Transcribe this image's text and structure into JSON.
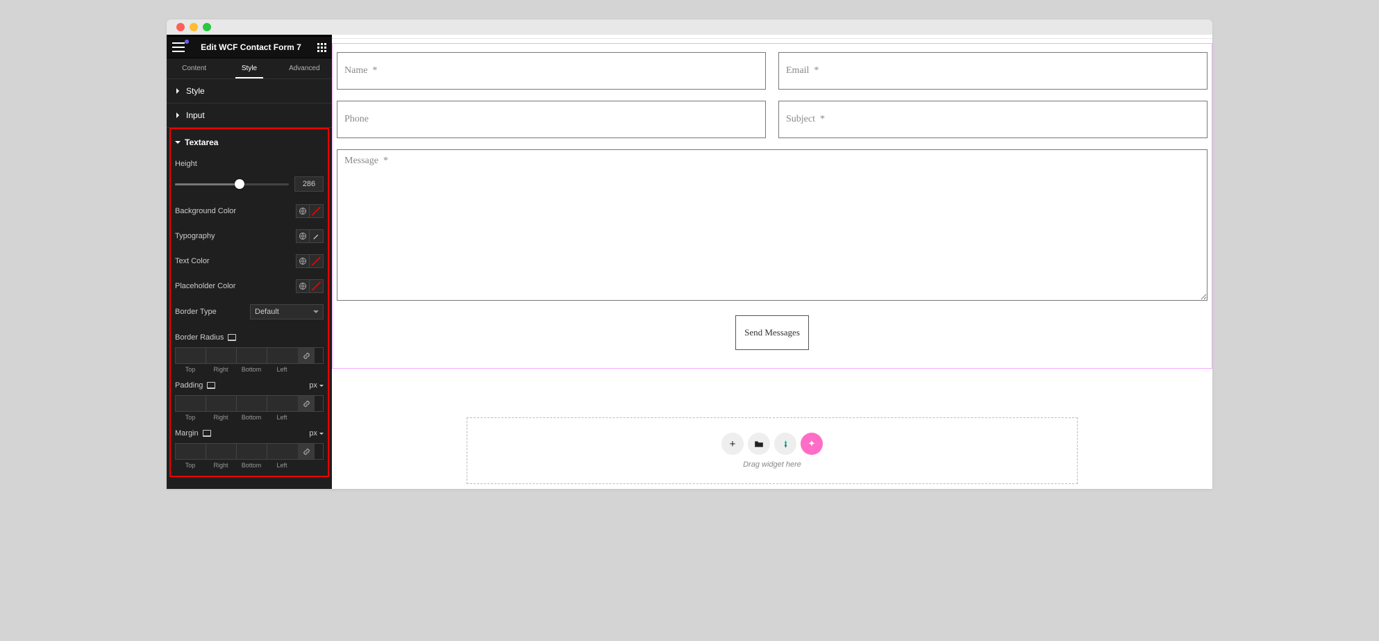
{
  "header": {
    "title": "Edit WCF Contact Form 7"
  },
  "tabs": {
    "content": "Content",
    "style": "Style",
    "advanced": "Advanced"
  },
  "accordion": {
    "style": "Style",
    "input": "Input",
    "textarea": "Textarea"
  },
  "controls": {
    "height_label": "Height",
    "height_value": "286",
    "bg_color": "Background Color",
    "typography": "Typography",
    "text_color": "Text Color",
    "placeholder_color": "Placeholder Color",
    "border_type": "Border Type",
    "border_type_value": "Default",
    "border_radius": "Border Radius",
    "padding": "Padding",
    "margin": "Margin",
    "unit_px": "px",
    "dir": {
      "top": "Top",
      "right": "Right",
      "bottom": "Bottom",
      "left": "Left"
    }
  },
  "form": {
    "name_ph": "Name  *",
    "email_ph": "Email  *",
    "phone_ph": "Phone",
    "subject_ph": "Subject  *",
    "message_ph": "Message  *",
    "submit": "Send Messages"
  },
  "dropzone": {
    "hint": "Drag widget here"
  }
}
